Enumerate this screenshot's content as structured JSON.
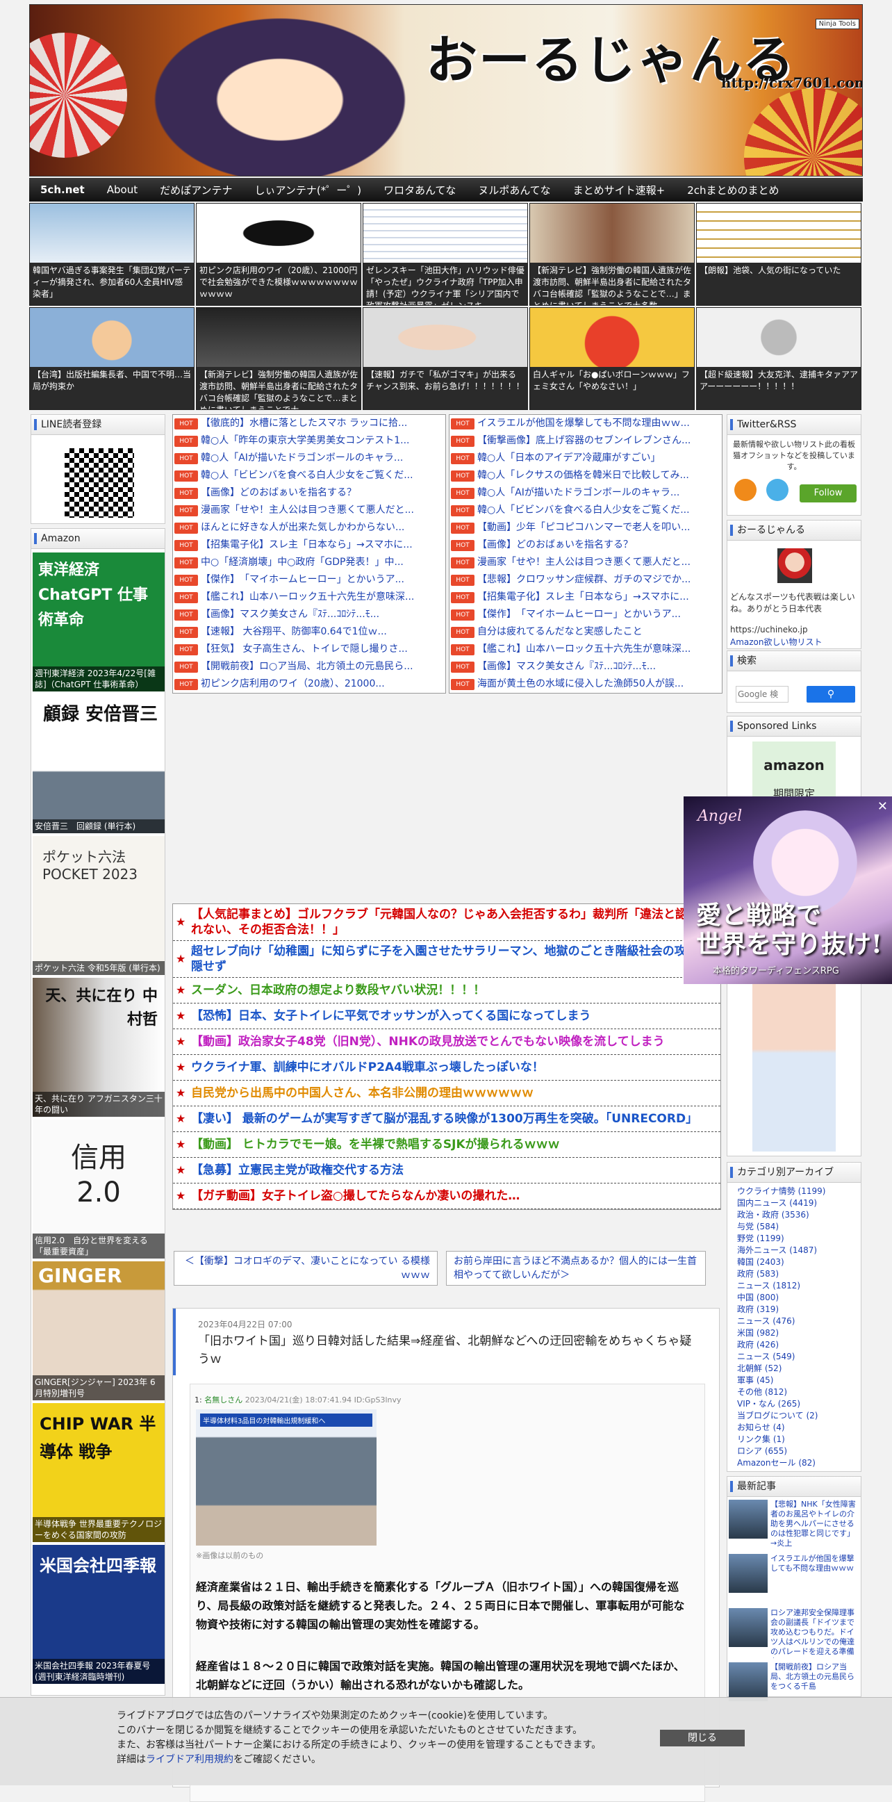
{
  "header": {
    "logo": "おーるじゃんる",
    "url": "http://crx7601.com",
    "ninja_badge": "Ninja Tools"
  },
  "nav": [
    "5ch.net",
    "About",
    "だめぽアンテナ",
    "しぃアンテナ(*゜ー゜)",
    "ワロタあんてな",
    "ヌルポあんてな",
    "まとめサイト速報+",
    "2chまとめのまとめ"
  ],
  "thumbs": [
    "韓国ヤバ過ぎる事案発生「集団幻覚パーティーが摘発され、参加者60人全員HIV感染者」",
    "初ピンク店利用のワイ（20歳）、21000円で社会勉強ができた模様ｗｗｗｗｗｗｗｗｗｗｗｗ",
    "ゼレンスキー「池田大作」ハリウッド俳優「やったぜ」ウクライナ政府「TPP加入申請！(予定）ウクライナ軍「シリア国内で政軍攻撃計画暴露」ゼレンスキ",
    "【新潟テレビ】強制労働の韓国人遺族が佐渡市訪問、朝鮮半島出身者に配給されたタバコ台帳確認「監獄のようなことで…」まとめに書いてしまうことで大多数",
    "【朗報】池袋、人気の街になっていた",
    "【台湾】出版社編集長者、中国で不明…当局が拘束か",
    "【新潟テレビ】強制労働の韓国人遺族が佐渡市訪問、朝鮮半島出身者に配給されたタバコ台帳確認「監獄のようなことで…まとめに書いてしまうことで大",
    "【速報】ガチで「私がゴマキ」が出来るチャンス到来、お前ら急げ！！！！！！！",
    "白人ギャル「お●ぱいボローンｗｗｗ」フェミ女さん「やめなさい！」",
    "【超ド級速報】大友克洋、逮捕キタァアアアーーーーーー！！！！！"
  ],
  "sidebar_left": {
    "line_title": "LINE読者登録",
    "amazon_title": "Amazon",
    "books": [
      "週刊東洋経済 2023年4/22号[雑誌]（ChatGPT 仕事術革命）",
      "安倍晋三　回顧録 (単行本)",
      "ポケット六法 令和5年版 (単行本)",
      "天、共に在り アフガニスタン三十年の闘い",
      "信用2.0　自分と世界を変える「最重要資産」",
      "GINGER[ジンジャー] 2023年 6月特別増刊号",
      "半導体戦争 世界最重要テクノロジーをめぐる国家間の攻防",
      "米国会社四季報 2023年春夏号 (週刊東洋経済臨時増刊)"
    ],
    "book_cover_text": [
      "東洋経済 ChatGPT 仕事術革命",
      "顧録 安倍晋三",
      "ポケット六法 POCKET 2023",
      "天、共に在り 中村哲",
      "信用 2.0",
      "GINGER",
      "CHIP WAR 半導体 戦争",
      "米国会社四季報"
    ]
  },
  "list_left": [
    "【徹底的】水槽に落としたスマホ ラッコに拾...",
    "韓○人「昨年の東京大学美男美女コンテスト1...",
    "韓○人「AIが描いたドラゴンボールのキャラ...",
    "韓○人「ビビンバを食べる白人少女をご覧くだ...",
    "【画像】どのおばぁいを指名する？",
    "漫画家「せや！主人公は目つき悪くて悪人だと...",
    "ほんとに好きな人が出来た気しかわからない...",
    "【招集電子化】スレ主「日本なら」→スマホに...",
    "中○「経済崩壊」中○政府「GDP発表！」中...",
    "【傑作】　「マイホームヒーロー」とかいうア...",
    "【艦これ】山本ハーロック五十六先生が意味深...",
    "【画像】マスク美女さん『ｽﾃ...ｺﾛｼﾃ...ﾓ...",
    "【速報】 大谷翔平、防御率0.64で1位ｗ...",
    "【狂気】 女子高生さん、トイレで隠し撮りさ...",
    "【開戦前夜】ロ○ア当局、北方領土の元島民ら...",
    "初ピンク店利用のワイ（20歳）、21000..."
  ],
  "list_right": [
    "イスラエルが他国を爆撃しても不問な理由ｗｗ...",
    "【衝撃画像】底上げ容器のセブンイレブンさん...",
    "韓○人「日本のアイデア冷蔵庫がすごい」",
    "韓○人「レクサスの価格を韓米日で比較してみ...",
    "韓○人「AIが描いたドラゴンボールのキャラ...",
    "韓○人「ビビンバを食べる白人少女をご覧くだ...",
    "【動画】少年「ピコピコハンマーで老人を叩い...",
    "【画像】どのおばぁいを指名する？",
    "漫画家「せや！主人公は目つき悪くて悪人だと...",
    "【悲報】クロワッサン症候群、ガチのマジでか...",
    "【招集電子化】スレ主「日本なら」→スマホに...",
    "【傑作】　「マイホームヒーロー」とかいうア...",
    "自分は疲れてるんだなと実感したこと",
    "【艦これ】山本ハーロック五十六先生が意味深...",
    "【画像】マスク美女さん『ｽﾃ...ｺﾛｼﾃ...ﾓ...",
    "海面が黄土色の水域に侵入した漁師50人が誤..."
  ],
  "pickups": [
    {
      "text": "【人気記事まとめ】ゴルフクラブ「元韓国人なの？じゃあ入会拒否するわ」裁判所「違法と認められない、その拒否合法！！」",
      "color": "#d40000"
    },
    {
      "text": "超セレブ向け「幼稚園」に知らずに子を入園させたサラリーマン、地獄のごとき階級社会の攻撃を隠せず",
      "color": "#1a55c8"
    },
    {
      "text": "スーダン、日本政府の想定より数段ヤバい状況！！！！",
      "color": "#3a9a1a"
    },
    {
      "text": "【恐怖】日本、女子トイレに平気でオッサンが入ってくる国になってしまう",
      "color": "#1a55c8"
    },
    {
      "text": "【動画】政治家女子48党（旧N党）、NHKの政見放送でとんでもない映像を流してしまう",
      "color": "#c020c0"
    },
    {
      "text": "ウクライナ軍、訓練中にオバルドP2A4戦車ぶっ壊したっぽいな！",
      "color": "#1a55c8"
    },
    {
      "text": "自民党から出馬中の中国人さん、本名非公開の理由ｗｗｗｗｗｗ",
      "color": "#e08a00"
    },
    {
      "text": "【凄い】 最新のゲームが実写すぎて脳が混乱する映像が1300万再生を突破。「UNRECORD」",
      "color": "#1a55c8"
    },
    {
      "text": "【動画】 ヒトカラでモー娘。を半裸で熱唱するSJKが撮られるｗｗｗ",
      "color": "#3a9a1a"
    },
    {
      "text": "【急募】立憲民主党が政権交代する方法",
      "color": "#1a55c8"
    },
    {
      "text": "【ガチ動画】女子トイレ盗○撮してたらなんか凄いの撮れた…",
      "color": "#d40000"
    }
  ],
  "pager": {
    "prev": "＜【衝撃】コオロギのデマ、凄いことになってい る模様ｗｗｗ",
    "next": "お前ら岸田に言うほど不満点あるか？個人的には一生首相やってて欲しいんだが＞"
  },
  "article": {
    "date": "2023年04月22日 07:00",
    "title": "「旧ホワイト国」巡り日韓対話した結果⇒経産省、北朝鮮などへの迂回密輸をめちゃくちゃ疑うｗ",
    "post_no": "1:",
    "post_name": "名無しさん",
    "post_meta": "2023/04/21(金) 18:07:41.94 ID:GpS3lnvy",
    "img_caption": "半導体材料3品目の対韓輸出規制緩和へ",
    "img_note": "※画像は以前のもの",
    "body1": "経済産業省は２１日、輸出手続きを簡素化する「グループＡ（旧ホワイト国）」への韓国復帰を巡り、局長級の政策対話を継続すると発表した。２４、２５両日に日本で開催し、軍事転用が可能な物資や技術に対する韓国の輸出管理の実効性を確認する。",
    "body2": "経産省は１８～２０日に韓国で政策対話を実施。韓国の輸出管理の運用状況を現地で調べたほか、北朝鮮などに迂回（うかい）輸出される恐れがないかも確認した。"
  },
  "sidebar_right": {
    "twitter_title": "Twitter&RSS",
    "twitter_text": "最新情報や欲しい物リスト此の看板猫オフショットなどを投稿しています。",
    "follow_label": "Follow",
    "about_title": "おーるじゃんる",
    "about_text": "どんなスポーツも代表戦は楽しいね。ありがとう日本代表",
    "about_link1": "https://uchineko.jp",
    "about_link2": "Amazon欲しい物リスト",
    "search_title": "検索",
    "search_placeholder": "Google 検",
    "sponsored_title": "Sponsored Links",
    "amazon_ad": "amazon",
    "amazon_ad_sub": "期間限定",
    "category_title": "カテゴリ別アーカイブ",
    "categories": [
      "ウクライナ情勢 (1199)",
      "国内ニュース (4419)",
      "政治・政府 (3536)",
      "与党 (584)",
      "野党 (1199)",
      "海外ニュース (1487)",
      "韓国 (2403)",
      "政府 (583)",
      "ニュース (1812)",
      "中国 (800)",
      "政府 (319)",
      "ニュース (476)",
      "米国 (982)",
      "政府 (426)",
      "ニュース (549)",
      "北朝鮮 (52)",
      "軍事 (45)",
      "その他 (812)",
      "VIP・なん (265)",
      "当ブログについて (2)",
      "お知らせ (4)",
      "リンク集 (1)",
      "ロシア (655)",
      "Amazonセール (82)"
    ],
    "recent_title": "最新記事",
    "recent": [
      "【悲報】NHK「女性障害者のお風呂やトイレの介助を男ヘルパーにさせるのは性犯罪と同じです」→炎上",
      "イスラエルが他国を爆撃しても不問な理由ｗｗｗ",
      "ロシア連邦安全保障理事会の副議長「ドイツまで攻め込むつもりだ。ドイツ人はベルリンでの俺達のパレードを迎える準備を」",
      "【開戦前夜】ロシア当局、北方領土の元島民らをつくる千島"
    ]
  },
  "popup": {
    "brand": "Angel",
    "title": "愛と戦略で\n世界を守り抜け!",
    "sub": "本格的タワーディフェンスRPG"
  },
  "cookie": {
    "line1": "ライブドアブログでは広告のパーソナライズや効果測定のためクッキー(cookie)を使用しています。",
    "line2": "このバナーを閉じるか閲覧を継続することでクッキーの使用を承認いただいたものとさせていただきます。",
    "line3": "また、お客様は当社パートナー企業における所定の手続きにより、クッキーの使用を管理することもできます。",
    "line4a": "詳細は",
    "line4link": "ライブドア利用規約",
    "line4b": "をご確認ください。",
    "close": "閉じる"
  }
}
